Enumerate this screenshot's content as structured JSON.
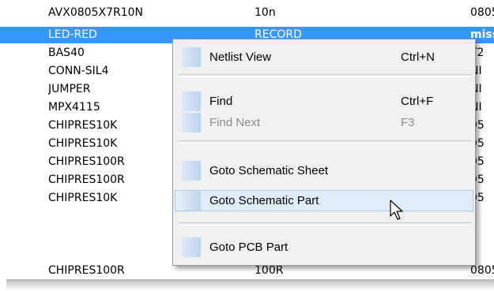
{
  "list": {
    "rows": [
      {
        "part": "AVX0805X7R10N",
        "value": "10n",
        "package": "0805",
        "selected": false
      },
      {
        "part": "LED-RED",
        "value": "RECORD",
        "package": "miss",
        "selected": true
      },
      {
        "part": "BAS40",
        "value": "",
        "package": "T2",
        "selected": false
      },
      {
        "part": "CONN-SIL4",
        "value": "",
        "package": "NI",
        "selected": false
      },
      {
        "part": "JUMPER",
        "value": "",
        "package": "NI",
        "selected": false
      },
      {
        "part": "MPX4115",
        "value": "",
        "package": "NI",
        "selected": false
      },
      {
        "part": "CHIPRES10K",
        "value": "",
        "package": "05",
        "selected": false
      },
      {
        "part": "CHIPRES10K",
        "value": "",
        "package": "05",
        "selected": false
      },
      {
        "part": "CHIPRES100R",
        "value": "",
        "package": "05",
        "selected": false
      },
      {
        "part": "CHIPRES100R",
        "value": "",
        "package": "05",
        "selected": false
      },
      {
        "part": "CHIPRES10K",
        "value": "",
        "package": "05",
        "selected": false
      },
      {
        "part": "CHIPRES100R",
        "value": "100R",
        "package": "0805",
        "selected": false
      }
    ]
  },
  "context_menu": {
    "items": [
      {
        "label": "Netlist View",
        "shortcut": "Ctrl+N",
        "enabled": true
      },
      {
        "label": "Find",
        "shortcut": "Ctrl+F",
        "enabled": true
      },
      {
        "label": "Find Next",
        "shortcut": "F3",
        "enabled": false
      },
      {
        "label": "Goto Schematic Sheet",
        "shortcut": "",
        "enabled": true
      },
      {
        "label": "Goto Schematic Part",
        "shortcut": "",
        "enabled": true,
        "hovered": true
      },
      {
        "label": "Goto PCB Part",
        "shortcut": "",
        "enabled": true
      }
    ]
  },
  "cursor": {
    "icon": "arrow-pointer-icon"
  }
}
